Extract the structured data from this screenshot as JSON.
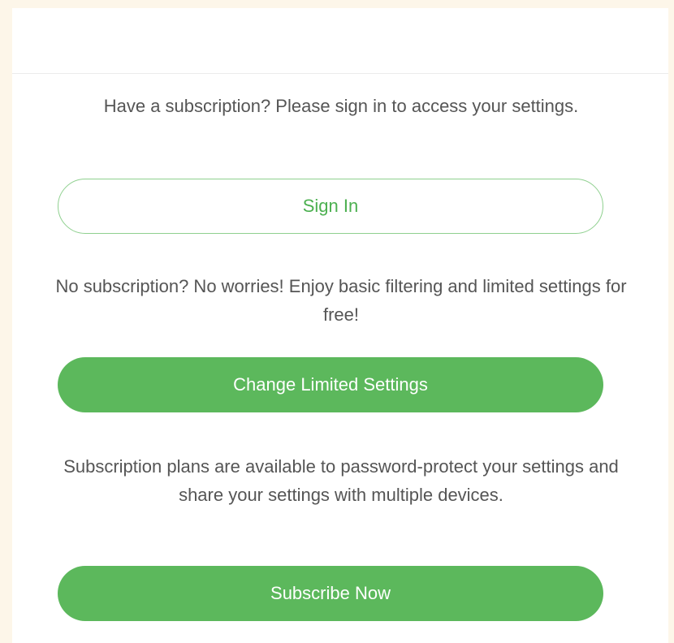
{
  "colors": {
    "page_background": "#fdf6e9",
    "panel_background": "#ffffff",
    "accent_green": "#5cb85c",
    "text_gray": "#555555"
  },
  "signin_section": {
    "message": "Have a subscription? Please sign in to access your settings.",
    "button_label": "Sign In"
  },
  "free_section": {
    "message": "No subscription? No worries! Enjoy basic filtering and limited settings for free!",
    "button_label": "Change Limited Settings"
  },
  "subscribe_section": {
    "message": "Subscription plans are available to password-protect your settings and share your settings with multiple devices.",
    "button_label": "Subscribe Now"
  }
}
